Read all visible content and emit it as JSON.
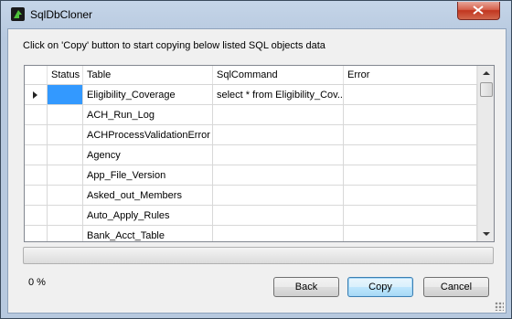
{
  "window": {
    "title": "SqlDbCloner",
    "close_tooltip": "Close"
  },
  "instruction": "Click on 'Copy' button to start copying below listed SQL objects data",
  "grid": {
    "columns": [
      "Status",
      "Table",
      "SqlCommand",
      "Error"
    ],
    "rows": [
      {
        "status": "",
        "table": "Eligibility_Coverage",
        "sqlcommand": "select * from Eligibility_Cov...",
        "error": "",
        "current": true,
        "selected": true
      },
      {
        "status": "",
        "table": "ACH_Run_Log",
        "sqlcommand": "",
        "error": ""
      },
      {
        "status": "",
        "table": "ACHProcessValidationError",
        "sqlcommand": "",
        "error": ""
      },
      {
        "status": "",
        "table": "Agency",
        "sqlcommand": "",
        "error": ""
      },
      {
        "status": "",
        "table": "App_File_Version",
        "sqlcommand": "",
        "error": ""
      },
      {
        "status": "",
        "table": "Asked_out_Members",
        "sqlcommand": "",
        "error": ""
      },
      {
        "status": "",
        "table": "Auto_Apply_Rules",
        "sqlcommand": "",
        "error": ""
      },
      {
        "status": "",
        "table": "Bank_Acct_Table",
        "sqlcommand": "",
        "error": ""
      }
    ]
  },
  "progress": {
    "value": 0,
    "label": "0 %"
  },
  "buttons": {
    "back": "Back",
    "copy": "Copy",
    "cancel": "Cancel"
  },
  "colors": {
    "selection": "#3399ff",
    "progress_fill": "#3fb618"
  }
}
